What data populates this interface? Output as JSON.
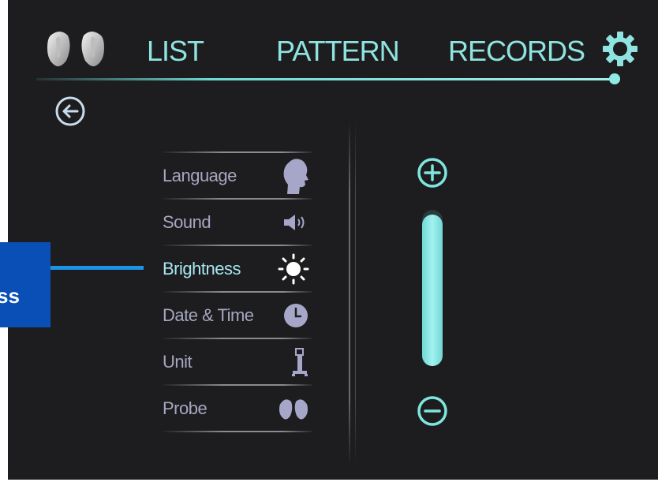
{
  "header": {
    "tabs": [
      {
        "label": "LIST"
      },
      {
        "label": "PATTERN"
      },
      {
        "label": "RECORDS"
      }
    ],
    "logo_icon": "probe-pair-icon",
    "settings_icon": "gear-icon"
  },
  "back_icon": "back-arrow-icon",
  "settings_menu": {
    "items": [
      {
        "label": "Language",
        "icon": "head-profile-icon"
      },
      {
        "label": "Sound",
        "icon": "speaker-icon"
      },
      {
        "label": "Brightness",
        "icon": "sun-icon",
        "active": true
      },
      {
        "label": "Date & Time",
        "icon": "clock-icon"
      },
      {
        "label": "Unit",
        "icon": "device-cart-icon"
      },
      {
        "label": "Probe",
        "icon": "probe-icon"
      }
    ]
  },
  "brightness_slider": {
    "increase_icon": "plus-circle-icon",
    "decrease_icon": "minus-circle-icon",
    "level": 0.97
  },
  "callout": {
    "text": "ss"
  },
  "colors": {
    "accent": "#8fe3e0",
    "background": "#1d1d1f",
    "menu_text": "#a6a6c0",
    "callout_bg": "#0a4fb5",
    "callout_line": "#1e93e3"
  }
}
